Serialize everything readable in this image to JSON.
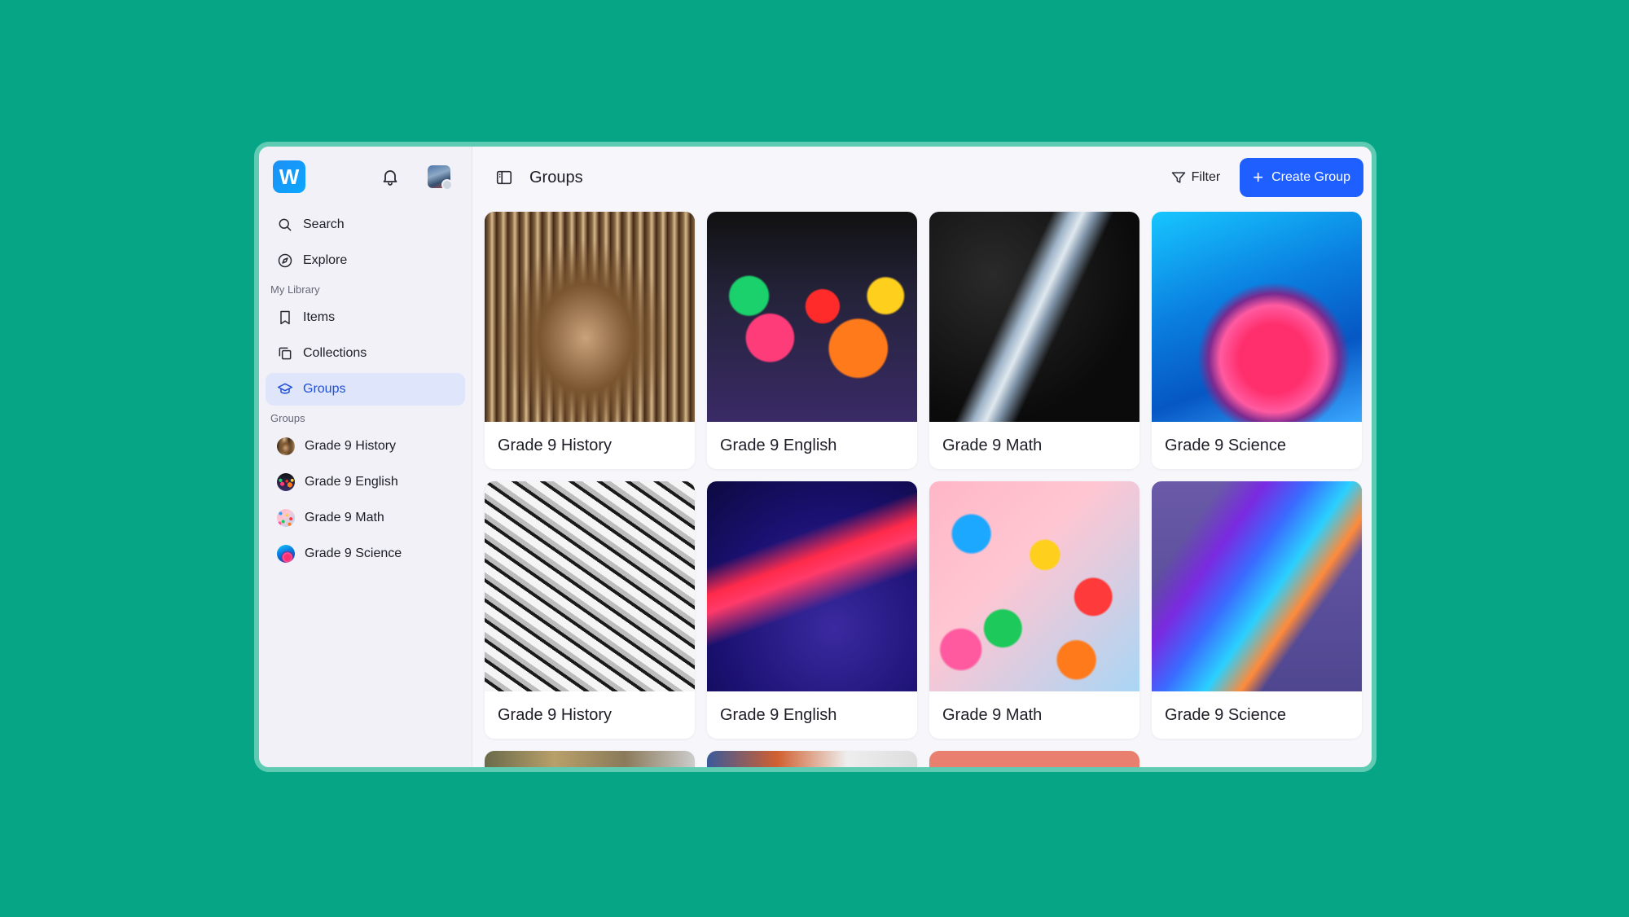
{
  "app": {
    "logo_letter": "W"
  },
  "sidebar": {
    "nav": [
      {
        "label": "Search",
        "icon": "search-icon"
      },
      {
        "label": "Explore",
        "icon": "compass-icon"
      }
    ],
    "library_label": "My Library",
    "library": [
      {
        "label": "Items",
        "icon": "bookmark-icon"
      },
      {
        "label": "Collections",
        "icon": "collections-icon"
      },
      {
        "label": "Groups",
        "icon": "graduation-cap-icon",
        "active": true
      }
    ],
    "groups_label": "Groups",
    "groups": [
      {
        "label": "Grade 9 History"
      },
      {
        "label": "Grade 9 English"
      },
      {
        "label": "Grade 9 Math"
      },
      {
        "label": "Grade 9 Science"
      }
    ]
  },
  "header": {
    "title": "Groups",
    "filter_label": "Filter",
    "create_label": "Create Group"
  },
  "cards": [
    {
      "label": "Grade 9 History"
    },
    {
      "label": "Grade 9 English"
    },
    {
      "label": "Grade 9 Math"
    },
    {
      "label": "Grade 9 Science"
    },
    {
      "label": "Grade 9 History"
    },
    {
      "label": "Grade 9 English"
    },
    {
      "label": "Grade 9 Math"
    },
    {
      "label": "Grade 9 Science"
    }
  ],
  "colors": {
    "background": "#05a585",
    "accent": "#1f5fff",
    "active_nav_bg": "#dfe6fb"
  }
}
